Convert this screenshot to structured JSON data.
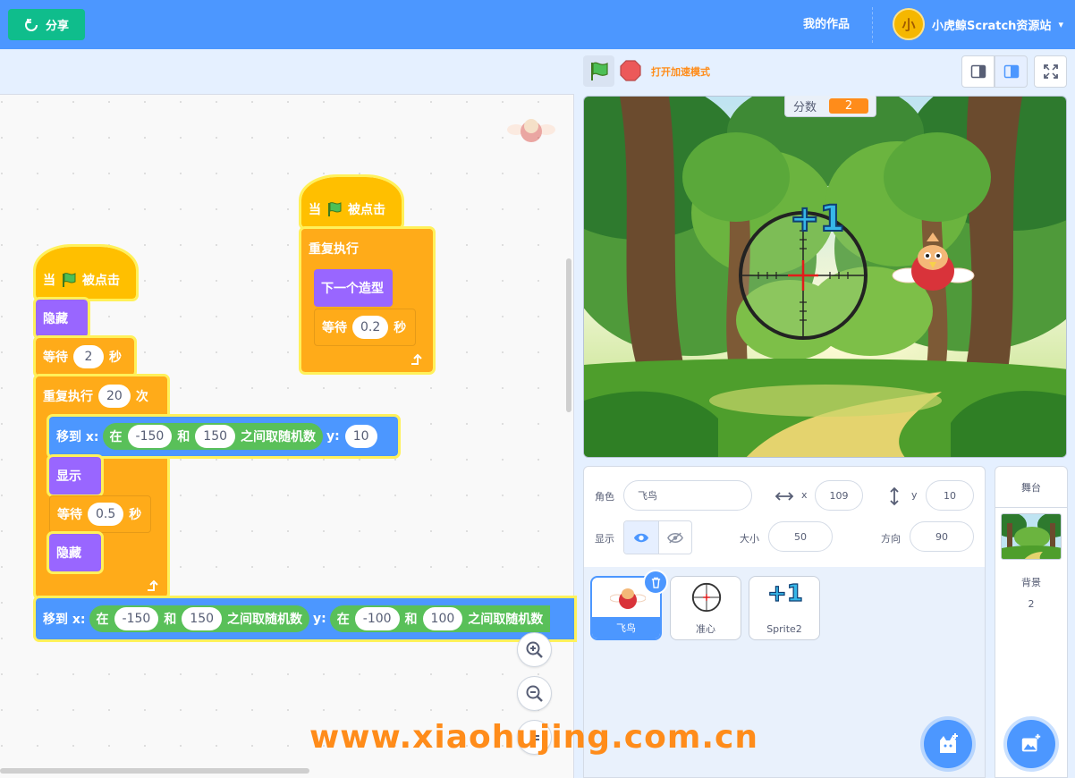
{
  "header": {
    "share_label": "分享",
    "my_works": "我的作品",
    "account_name": "小虎鲸Scratch资源站",
    "avatar_letter": "小",
    "caret": "▾",
    "brand_color": "#4c97ff"
  },
  "stage_toolbar": {
    "turbo_label": "打开加速模式"
  },
  "score_monitor": {
    "label": "分数",
    "value": "2"
  },
  "stage_overlay": {
    "plus_one": "+1"
  },
  "scripts": {
    "left": {
      "hat_when": "当",
      "hat_clicked": "被点击",
      "hide1": "隐藏",
      "wait_label": "等待",
      "wait_value": "2",
      "wait_unit": "秒",
      "repeat_label": "重复执行",
      "repeat_count": "20",
      "repeat_unit": "次",
      "goto_label": "移到 x:",
      "op_in": "在",
      "op_a": "-150",
      "op_and": "和",
      "op_b": "150",
      "op_pick": "之间取随机数",
      "y_label": "y:",
      "y_value": "10",
      "show": "显示",
      "wait2_label": "等待",
      "wait2_value": "0.5",
      "wait2_unit": "秒",
      "hide2": "隐藏",
      "goto2_label": "移到 x:",
      "op2_in": "在",
      "op2_a": "-150",
      "op2_and": "和",
      "op2_b": "150",
      "op2_pick": "之间取随机数",
      "y2_label": "y:",
      "op3_in": "在",
      "op3_a": "-100",
      "op3_and": "和",
      "op3_b": "100",
      "op3_pick": "之间取随机数"
    },
    "right": {
      "hat_when": "当",
      "hat_clicked": "被点击",
      "forever": "重复执行",
      "next_costume": "下一个造型",
      "wait_label": "等待",
      "wait_value": "0.2",
      "wait_unit": "秒"
    }
  },
  "sprite_info": {
    "sprite_label": "角色",
    "sprite_name": "飞鸟",
    "x_label": "x",
    "x_value": "109",
    "y_label": "y",
    "y_value": "10",
    "show_label": "显示",
    "size_label": "大小",
    "size_value": "50",
    "direction_label": "方向",
    "direction_value": "90"
  },
  "sprites": [
    {
      "name": "飞鸟",
      "selected": true
    },
    {
      "name": "准心",
      "selected": false
    },
    {
      "name": "Sprite2",
      "selected": false
    }
  ],
  "stage_pane": {
    "title": "舞台",
    "backdrop_label": "背景",
    "backdrop_count": "2"
  },
  "watermark": "www.xiaohujing.com.cn"
}
